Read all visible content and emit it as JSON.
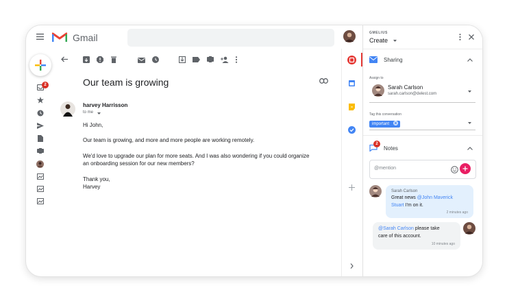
{
  "gmail": {
    "app_name": "Gmail",
    "rail_badge": "2",
    "email": {
      "subject": "Our team is growing",
      "sender": "harvey Harrisson",
      "recipient_label": "to me",
      "greeting": "Hi John,",
      "paragraph1": "Our team is growing, and more and more people are working remotely.",
      "paragraph2_line1": "We'd love to upgrade our plan for more seats. And I was also wondering if you could organize",
      "paragraph2_line2": "an onboarding session for our new members?",
      "signoff": "Thank you,",
      "signature": "Harvey"
    }
  },
  "panel": {
    "brand": "GMELIUS",
    "title": "Create",
    "sharing": {
      "title": "Sharing",
      "assign_label": "Assign to",
      "assignee_name": "Sarah Carlson",
      "assignee_email": "sarah.carlson@delest.com",
      "tag_label": "Tag this conversation",
      "tag": "important"
    },
    "notes": {
      "title": "Notes",
      "badge": "2",
      "input_placeholder": "@mention",
      "messages": [
        {
          "author": "Sarah Carlson",
          "text_start": "Great news ",
          "mention": "@John Maverick Stuart",
          "mention_line1": "@John Maverick",
          "mention_line2": "Stuart",
          "text_end": " I'm on it.",
          "time": "2 minutes ago"
        },
        {
          "mention": "@Sarah Carlson",
          "text_line1": " please take",
          "text_line2": "care of this account.",
          "time": "10 minutes ago"
        }
      ]
    }
  },
  "colors": {
    "gmail_red": "#ea4335",
    "accent_blue": "#4285f4",
    "add_pink": "#e91e63",
    "badge_red": "#d93025"
  }
}
